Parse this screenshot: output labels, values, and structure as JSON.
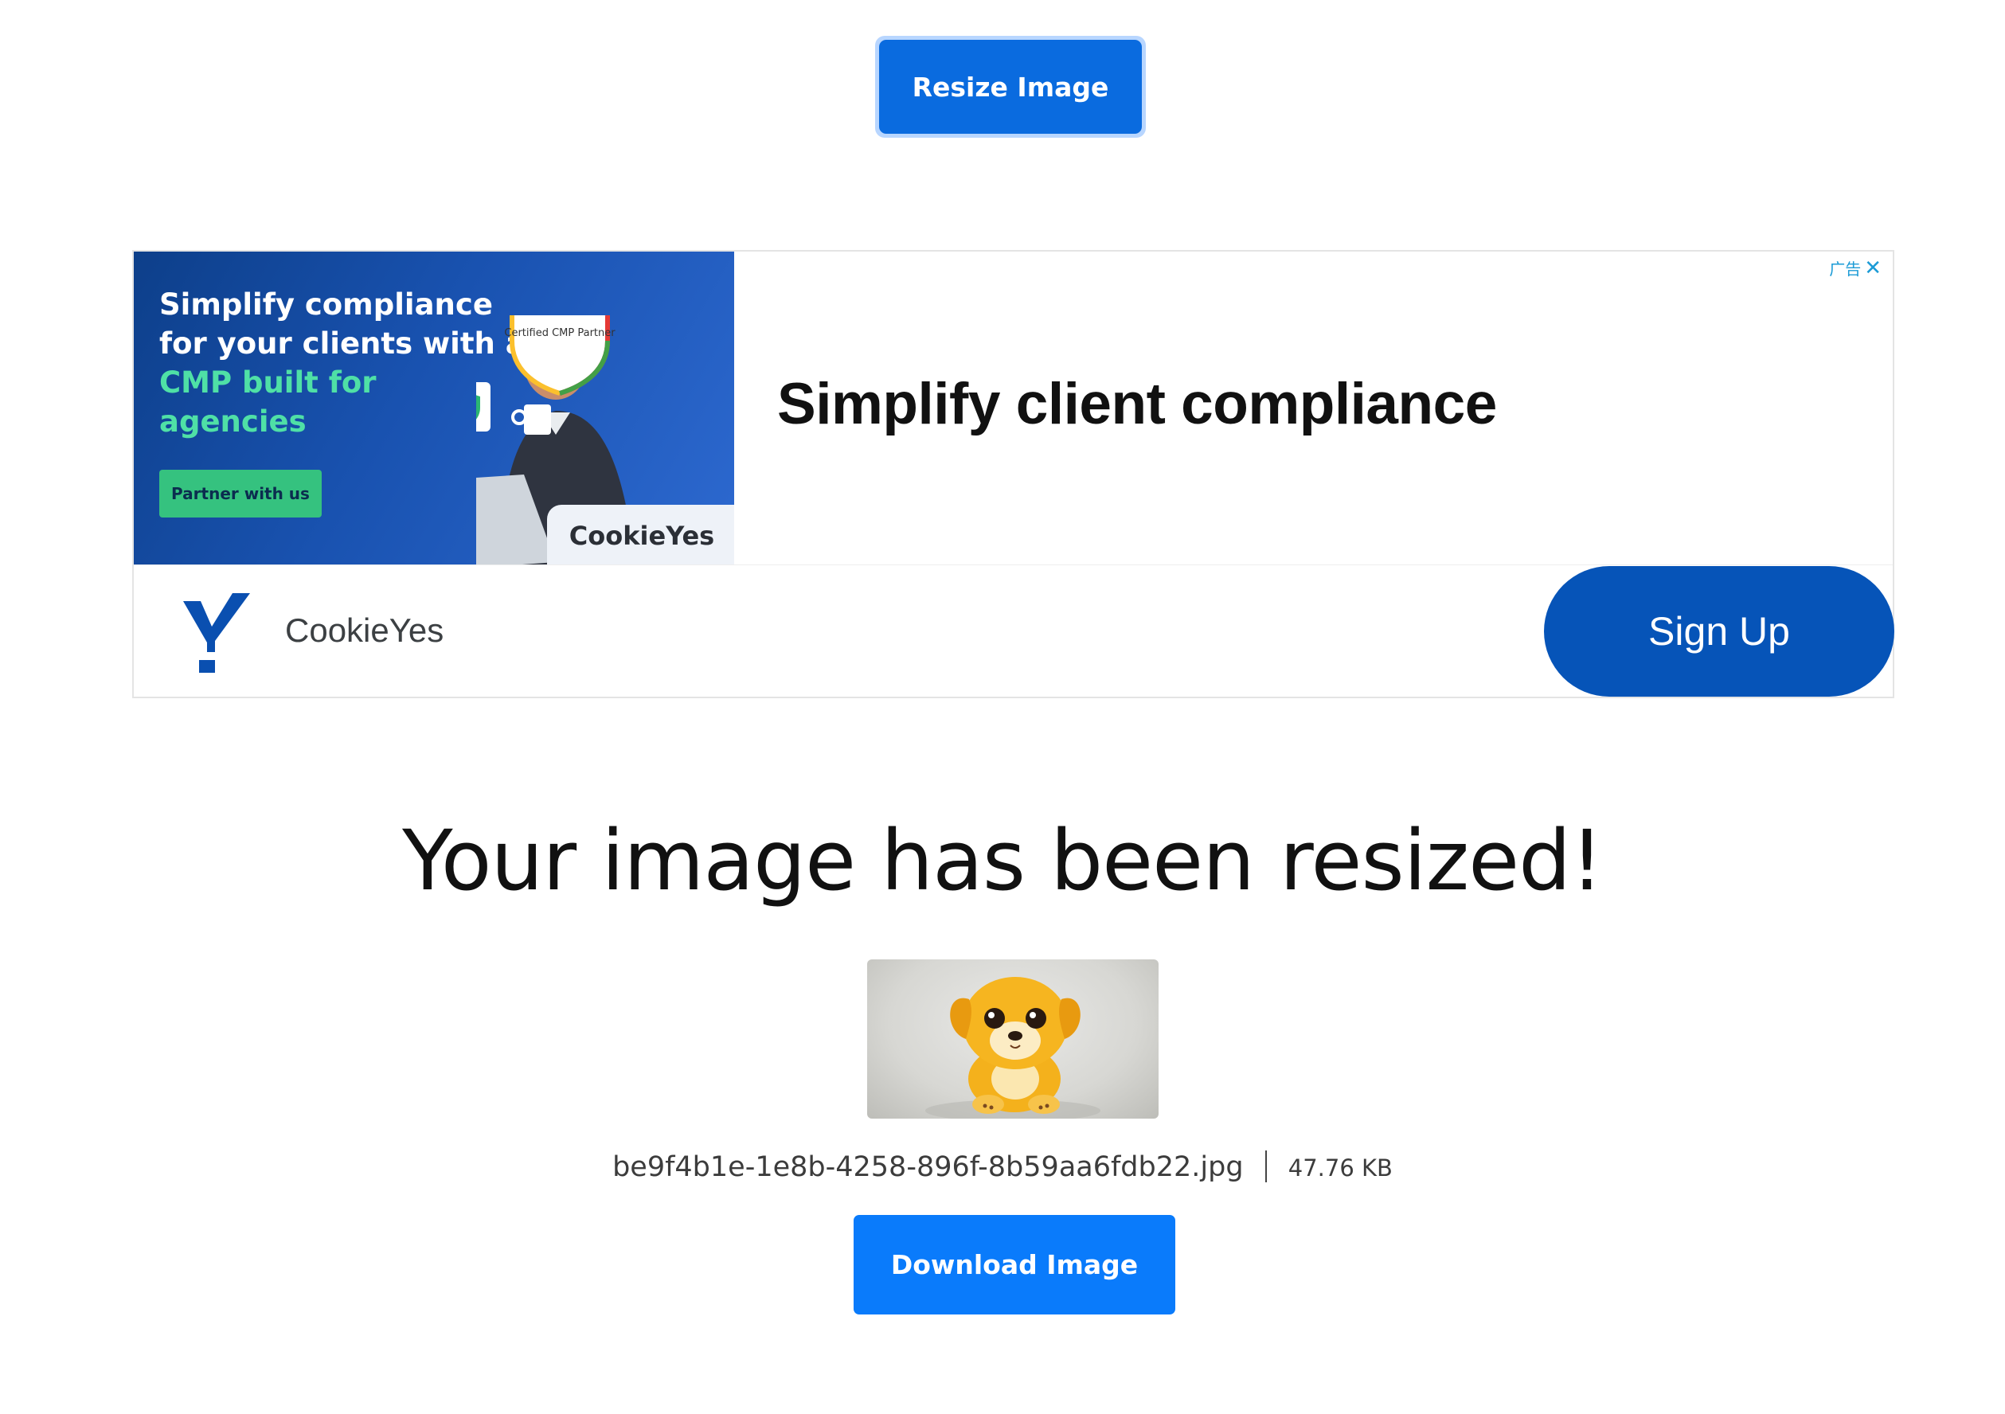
{
  "toolbar": {
    "resize_label": "Resize Image"
  },
  "ad": {
    "image_copy": {
      "line1": "Simplify compliance",
      "line2": "for your clients with a",
      "line3": "CMP built for",
      "line4": "agencies"
    },
    "partner_button": "Partner with us",
    "badge": "Certified CMP Partner",
    "image_brand": "CookieYes",
    "headline": "Simplify client compliance",
    "ad_label": "广告",
    "close_icon": "close-icon",
    "brand_name": "CookieYes",
    "signup_label": "Sign Up"
  },
  "result": {
    "title": "Your image has been resized!",
    "file_name": "be9f4b1e-1e8b-4258-896f-8b59aa6fdb22.jpg",
    "file_size": "47.76 KB",
    "download_label": "Download Image"
  },
  "colors": {
    "resize_button": "#0a6bdf",
    "download_button": "#0a7bfb",
    "signup_button": "#0654b8",
    "ad_background": "#1952b0",
    "ad_accent_green": "#4fe0a6"
  }
}
